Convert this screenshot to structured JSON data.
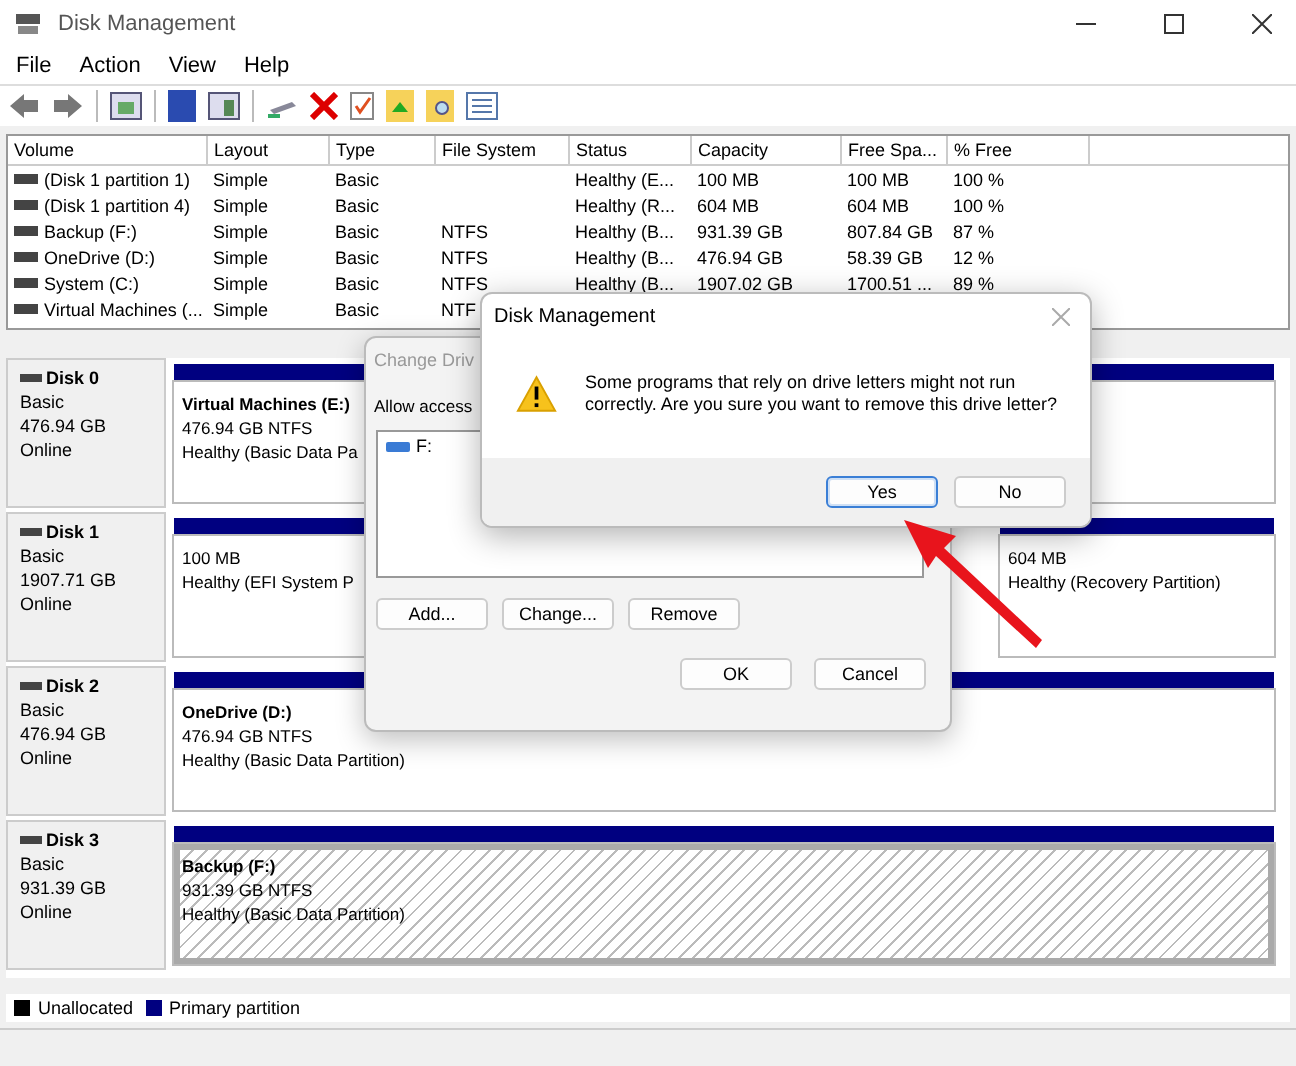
{
  "window": {
    "title": "Disk Management"
  },
  "menu": [
    "File",
    "Action",
    "View",
    "Help"
  ],
  "table": {
    "columns": [
      "Volume",
      "Layout",
      "Type",
      "File System",
      "Status",
      "Capacity",
      "Free Spa...",
      "% Free"
    ],
    "rows": [
      [
        "(Disk 1 partition 1)",
        "Simple",
        "Basic",
        "",
        "Healthy (E...",
        "100 MB",
        "100 MB",
        "100 %"
      ],
      [
        "(Disk 1 partition 4)",
        "Simple",
        "Basic",
        "",
        "Healthy (R...",
        "604 MB",
        "604 MB",
        "100 %"
      ],
      [
        "Backup (F:)",
        "Simple",
        "Basic",
        "NTFS",
        "Healthy (B...",
        "931.39 GB",
        "807.84 GB",
        "87 %"
      ],
      [
        "OneDrive (D:)",
        "Simple",
        "Basic",
        "NTFS",
        "Healthy (B...",
        "476.94 GB",
        "58.39 GB",
        "12 %"
      ],
      [
        "System (C:)",
        "Simple",
        "Basic",
        "NTFS",
        "Healthy (B...",
        "1907.02 GB",
        "1700.51 ...",
        "89 %"
      ],
      [
        "Virtual Machines (...",
        "Simple",
        "Basic",
        "NTF",
        "",
        "",
        "",
        ""
      ]
    ]
  },
  "disks": [
    {
      "name": "Disk 0",
      "type": "Basic",
      "size": "476.94 GB",
      "state": "Online",
      "partitions": [
        {
          "name": "Virtual Machines  (E:)",
          "lines": [
            "476.94 GB NTFS",
            "Healthy (Basic Data Pa"
          ],
          "selected": false
        }
      ]
    },
    {
      "name": "Disk 1",
      "type": "Basic",
      "size": "1907.71 GB",
      "state": "Online",
      "partitions": [
        {
          "lines": [
            "100 MB",
            "Healthy (EFI System P"
          ],
          "selected": false
        },
        {
          "lines": [
            "604 MB",
            "Healthy (Recovery Partition)"
          ],
          "selected": false
        }
      ]
    },
    {
      "name": "Disk 2",
      "type": "Basic",
      "size": "476.94 GB",
      "state": "Online",
      "partitions": [
        {
          "name": "OneDrive  (D:)",
          "lines": [
            "476.94 GB NTFS",
            "Healthy (Basic Data Partition)"
          ],
          "selected": false
        }
      ]
    },
    {
      "name": "Disk 3",
      "type": "Basic",
      "size": "931.39 GB",
      "state": "Online",
      "partitions": [
        {
          "name": "Backup  (F:)",
          "lines": [
            "931.39 GB NTFS",
            "Healthy (Basic Data Partition)"
          ],
          "selected": true
        }
      ]
    }
  ],
  "legend": [
    {
      "label": "Unallocated",
      "color": "#000000"
    },
    {
      "label": "Primary partition",
      "color": "#000080"
    }
  ],
  "change_dialog": {
    "title": "Change Driv",
    "prompt": "Allow access",
    "items": [
      "F:"
    ],
    "buttons": [
      "Add...",
      "Change...",
      "Remove"
    ],
    "footer_buttons": [
      "OK",
      "Cancel"
    ]
  },
  "message_dialog": {
    "title": "Disk Management",
    "message": "Some programs that rely on drive letters might not run correctly. Are you sure you want to remove this drive letter?",
    "buttons": [
      {
        "label": "Yes",
        "selected": true
      },
      {
        "label": "No",
        "selected": false
      }
    ]
  }
}
